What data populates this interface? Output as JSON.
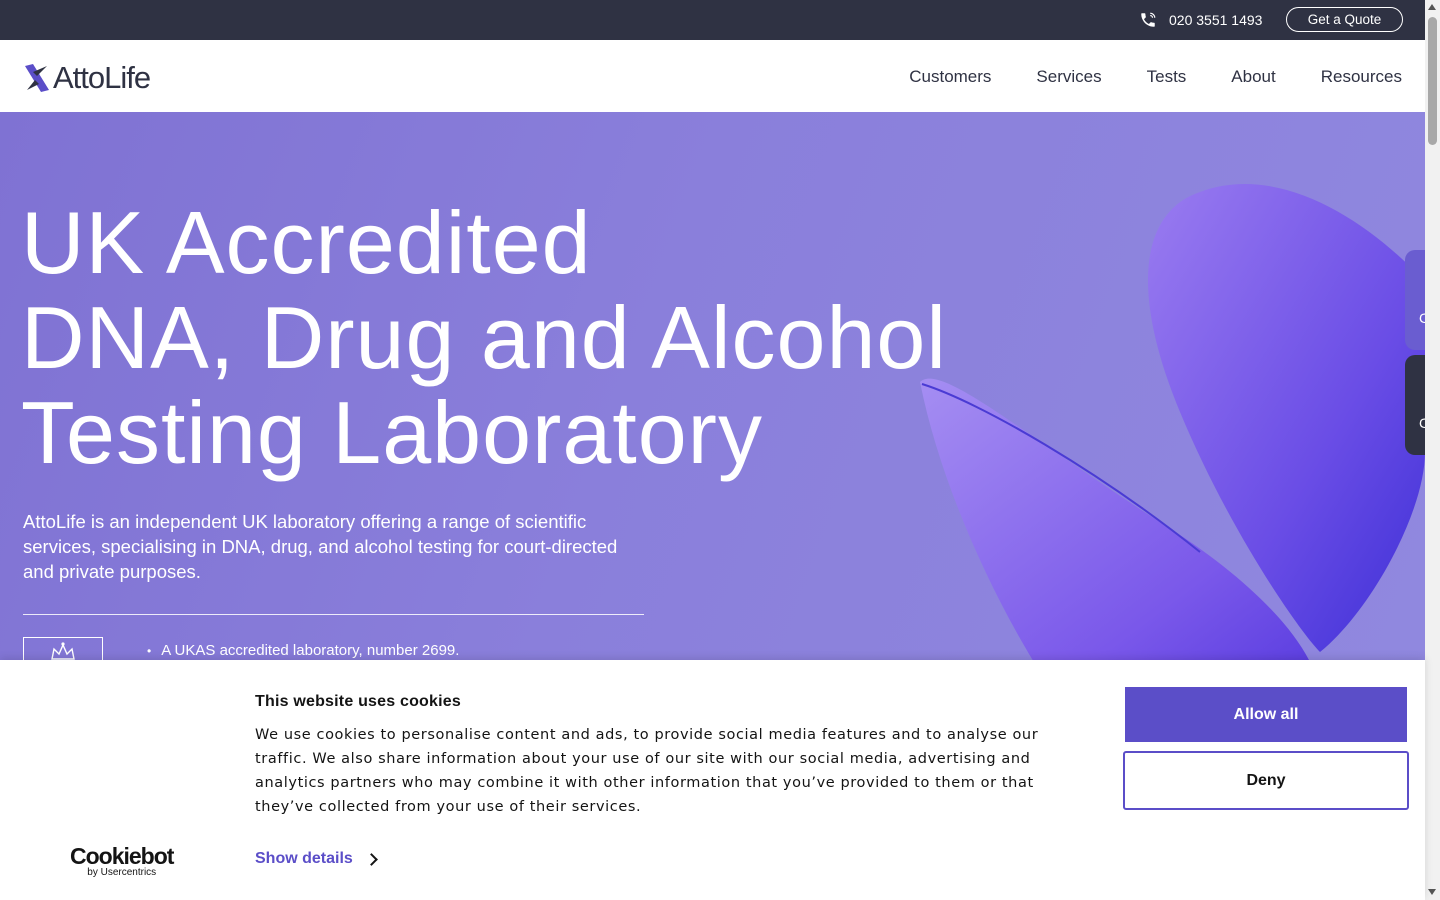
{
  "topbar": {
    "phone": "020 3551 1493",
    "phone_icon": "phone-icon",
    "quote_label": "Get a Quote"
  },
  "header": {
    "logo_text": "AttoLife",
    "nav": [
      "Customers",
      "Services",
      "Tests",
      "About",
      "Resources"
    ]
  },
  "hero": {
    "title_lines": [
      "UK Accredited",
      "DNA, Drug and Alcohol",
      "Testing Laboratory"
    ],
    "intro": "AttoLife is an independent UK laboratory offering a range of scientific services, specialising in DNA, drug, and alcohol testing for court-directed and private purposes.",
    "bullet": "A UKAS accredited laboratory, number 2699.",
    "crest_icon": "crown-crest-icon"
  },
  "side_tabs": [
    "C",
    "C"
  ],
  "cookie": {
    "title": "This website uses cookies",
    "body": "We use cookies to personalise content and ads, to provide social media features and to analyse our traffic. We also share information about your use of our site with our social media, advertising and analytics partners who may combine it with other information that you’ve provided to them or that they’ve collected from your use of their services.",
    "details_label": "Show details",
    "allow_label": "Allow all",
    "deny_label": "Deny",
    "brand_name": "Cookiebot",
    "brand_by": "by Usercentrics"
  },
  "colors": {
    "topbar_bg": "#2f3243",
    "hero_bg": "#8a7fdb",
    "accent": "#5b4ec8",
    "text_dark": "#2f3243"
  }
}
